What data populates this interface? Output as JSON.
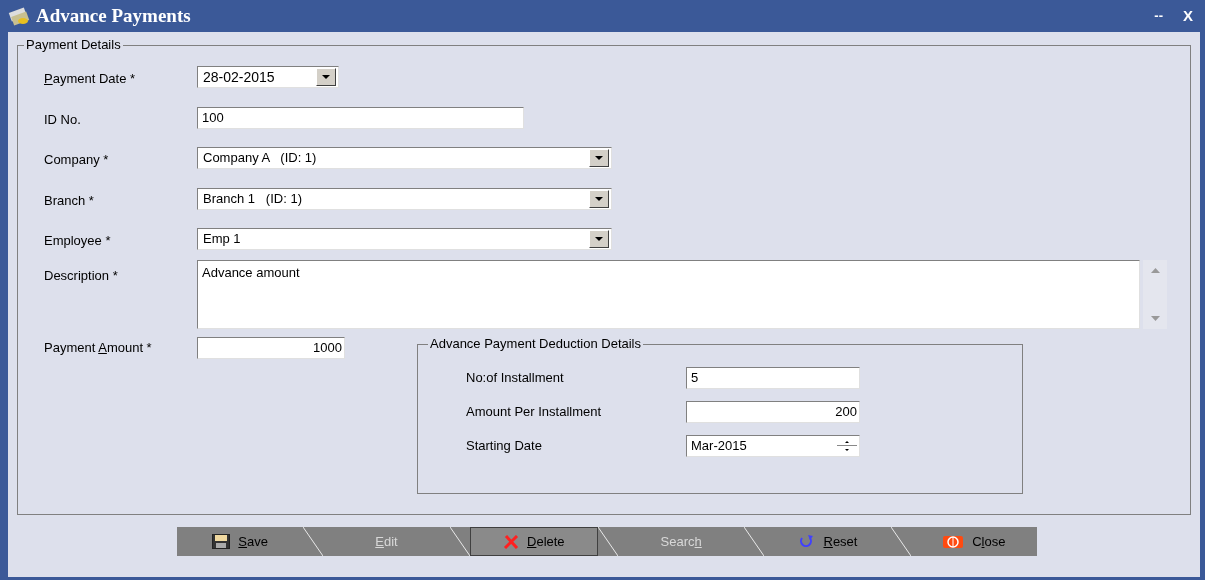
{
  "window": {
    "title": "Advance Payments",
    "controls": [
      "--",
      "X"
    ]
  },
  "payment_details": {
    "title": "Payment Details",
    "fields": [
      {
        "kind": "date_combo",
        "label": {
          "key": "P",
          "after": "ayment Date *"
        },
        "value": "28-02-2015"
      },
      {
        "kind": "text",
        "label": "ID No.",
        "value": "100"
      },
      {
        "kind": "combo",
        "label": "Company *",
        "value": "Company A   (ID: 1)"
      },
      {
        "kind": "combo",
        "label": "Branch *",
        "value": "Branch 1   (ID: 1)"
      },
      {
        "kind": "combo",
        "label": "Employee *",
        "value": "Emp 1"
      },
      {
        "kind": "textarea",
        "label": "Description *",
        "value": "Advance amount"
      }
    ],
    "amount": {
      "label": {
        "before": "Payment ",
        "key": "A",
        "after": "mount *"
      },
      "value": "1000"
    },
    "deduction": {
      "title": "Advance Payment Deduction Details",
      "fields": [
        {
          "kind": "text",
          "label": "No:of Installment",
          "value": "5"
        },
        {
          "kind": "number",
          "label": "Amount Per Installment",
          "value": "200"
        },
        {
          "kind": "spin",
          "label": "Starting Date",
          "value": "Mar-2015"
        }
      ]
    }
  },
  "buttons": [
    {
      "kind": "save",
      "label": {
        "key": "S",
        "after": "ave"
      },
      "disabled": false,
      "pressed": false
    },
    {
      "kind": "edit",
      "label": {
        "key": "E",
        "after": "dit"
      },
      "disabled": true,
      "pressed": false
    },
    {
      "kind": "delete",
      "label": {
        "key": "D",
        "after": "elete"
      },
      "disabled": false,
      "pressed": true
    },
    {
      "kind": "search",
      "label": {
        "before": "Searc",
        "key": "h"
      },
      "disabled": true,
      "pressed": false
    },
    {
      "kind": "reset",
      "label": {
        "key": "R",
        "after": "eset"
      },
      "disabled": false,
      "pressed": false
    },
    {
      "kind": "close",
      "label": {
        "before": "C",
        "key": "l",
        "after": "ose"
      },
      "disabled": false,
      "pressed": false
    }
  ]
}
